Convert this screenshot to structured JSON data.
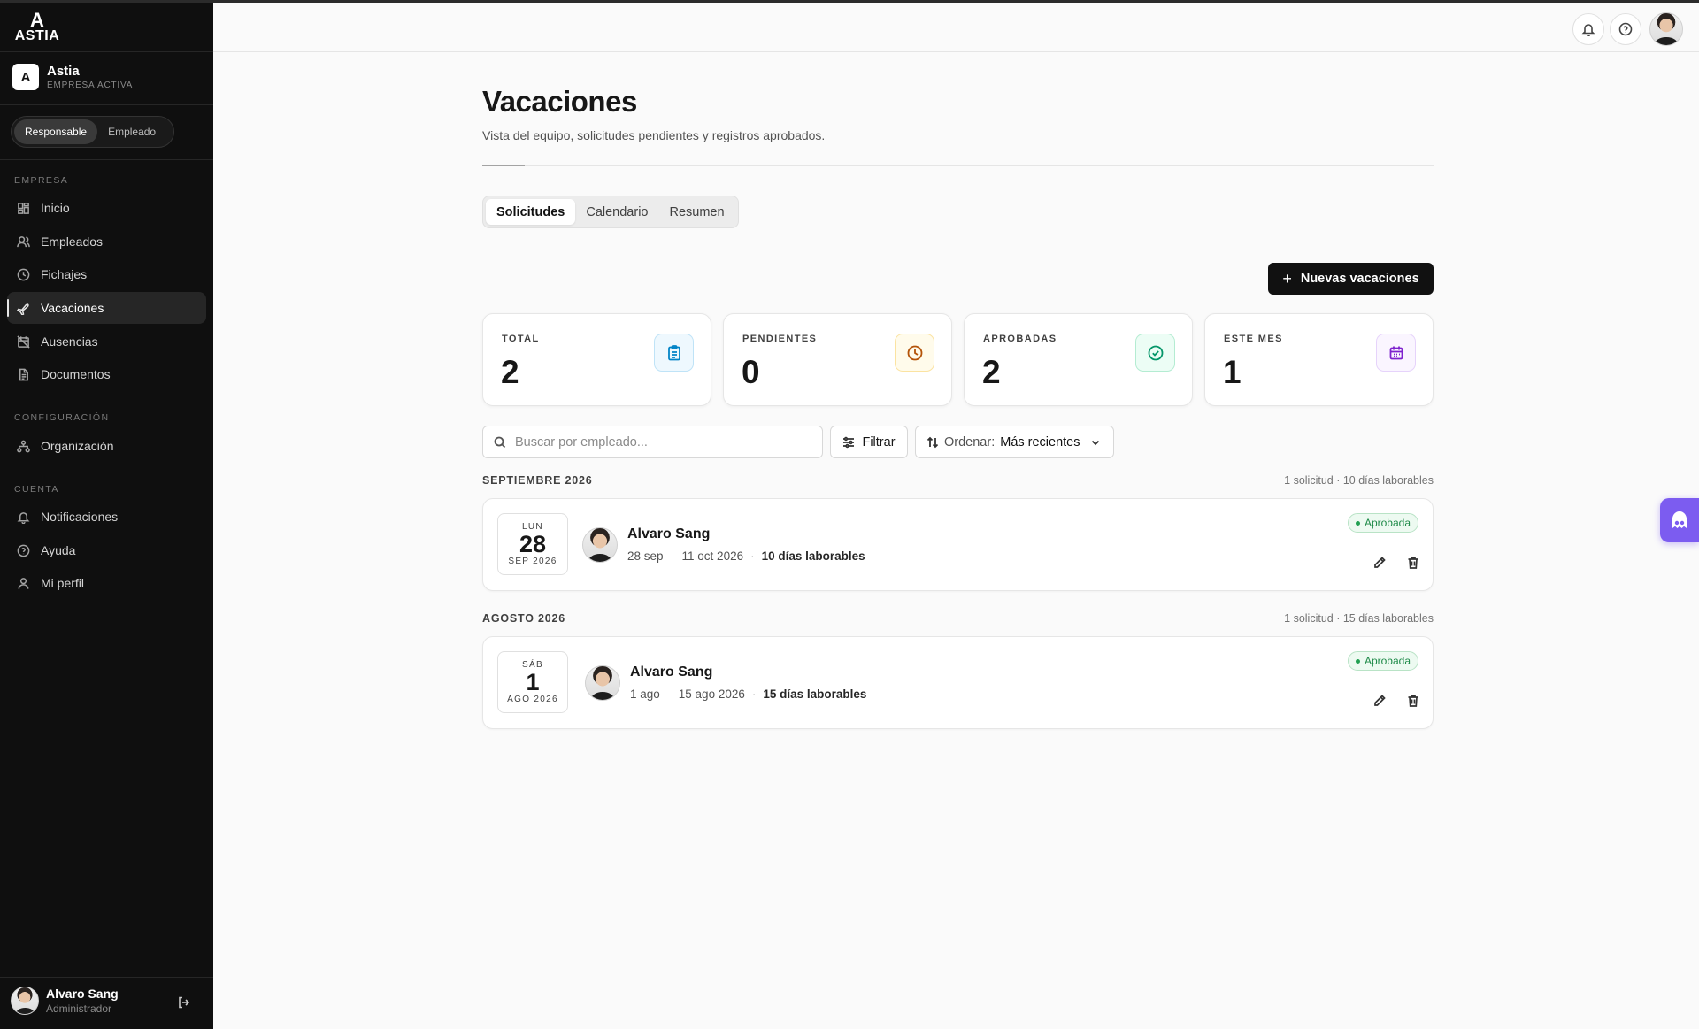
{
  "brand": {
    "logo_mark": "A",
    "logo_text": "ASTIA"
  },
  "company": {
    "badge": "A",
    "name": "Astia",
    "subtitle": "EMPRESA ACTIVA"
  },
  "role_toggle": {
    "options": [
      "Responsable",
      "Empleado"
    ],
    "selected": "Responsable"
  },
  "sidebar": {
    "sections": [
      {
        "title": "EMPRESA",
        "items": [
          {
            "label": "Inicio",
            "icon": "grid-icon"
          },
          {
            "label": "Empleados",
            "icon": "users-icon"
          },
          {
            "label": "Fichajes",
            "icon": "clock-icon"
          },
          {
            "label": "Vacaciones",
            "icon": "plane-icon",
            "active": true
          },
          {
            "label": "Ausencias",
            "icon": "calendar-off-icon"
          },
          {
            "label": "Documentos",
            "icon": "file-icon"
          }
        ]
      },
      {
        "title": "CONFIGURACIÓN",
        "items": [
          {
            "label": "Organización",
            "icon": "org-chart-icon"
          }
        ]
      },
      {
        "title": "CUENTA",
        "items": [
          {
            "label": "Notificaciones",
            "icon": "bell-icon"
          },
          {
            "label": "Ayuda",
            "icon": "help-icon"
          },
          {
            "label": "Mi perfil",
            "icon": "user-icon"
          }
        ]
      }
    ]
  },
  "current_user": {
    "name": "Alvaro Sang",
    "role": "Administrador"
  },
  "page": {
    "title": "Vacaciones",
    "subtitle": "Vista del equipo, solicitudes pendientes y registros aprobados.",
    "tabs": [
      {
        "label": "Solicitudes",
        "active": true
      },
      {
        "label": "Calendario",
        "active": false
      },
      {
        "label": "Resumen",
        "active": false
      }
    ],
    "new_button": "Nuevas vacaciones"
  },
  "stats": [
    {
      "label": "TOTAL",
      "value": "2",
      "icon": "clipboard-icon",
      "color": "#0284c7"
    },
    {
      "label": "PENDIENTES",
      "value": "0",
      "icon": "clock-icon",
      "color": "#b45309"
    },
    {
      "label": "APROBADAS",
      "value": "2",
      "icon": "check-circle-icon",
      "color": "#059669"
    },
    {
      "label": "ESTE MES",
      "value": "1",
      "icon": "calendar-icon",
      "color": "#7e22ce"
    }
  ],
  "toolbar": {
    "search_placeholder": "Buscar por empleado...",
    "filter_label": "Filtrar",
    "sort_label": "Ordenar:",
    "sort_value": "Más recientes"
  },
  "groups": [
    {
      "title": "SEPTIEMBRE 2026",
      "meta": "1 solicitud · 10 días laborables",
      "request": {
        "dow": "LUN",
        "day": "28",
        "month": "SEP 2026",
        "name": "Alvaro Sang",
        "range": "28 sep — 11 oct 2026",
        "days": "10 días laborables",
        "status": "Aprobada"
      }
    },
    {
      "title": "AGOSTO 2026",
      "meta": "1 solicitud · 15 días laborables",
      "request": {
        "dow": "SÁB",
        "day": "1",
        "month": "AGO 2026",
        "name": "Alvaro Sang",
        "range": "1 ago — 15 ago 2026",
        "days": "15 días laborables",
        "status": "Aprobada"
      }
    }
  ],
  "colors": {
    "accent": "#111111",
    "approved": "#1e8a48",
    "assistant": "#7c5cf0"
  }
}
